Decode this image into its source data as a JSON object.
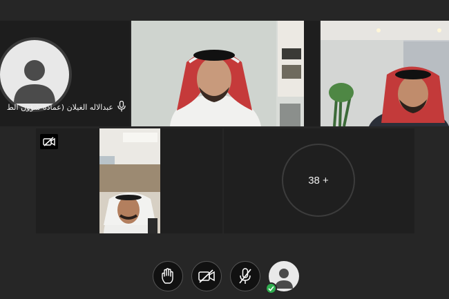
{
  "participants": {
    "avatar_tile": {
      "name": "عبدالاله الغيلان (عمادة شؤون الط",
      "mic_state": "on"
    },
    "video_tiles": [
      {
        "label": "participant-video-1"
      },
      {
        "label": "participant-video-2"
      },
      {
        "label": "participant-video-3",
        "camera_muted": true
      }
    ],
    "more_count": "38 +"
  },
  "toolbar": {
    "buttons": [
      {
        "name": "raise-hand",
        "icon": "hand-icon"
      },
      {
        "name": "camera-toggle",
        "icon": "video-off-icon"
      },
      {
        "name": "mic-toggle",
        "icon": "mic-off-icon"
      },
      {
        "name": "self-view",
        "icon": "user-icon",
        "status": "connected"
      }
    ]
  },
  "colors": {
    "background": "#262626",
    "tile": "#1f1f1f",
    "status_ok": "#2fae4f"
  }
}
